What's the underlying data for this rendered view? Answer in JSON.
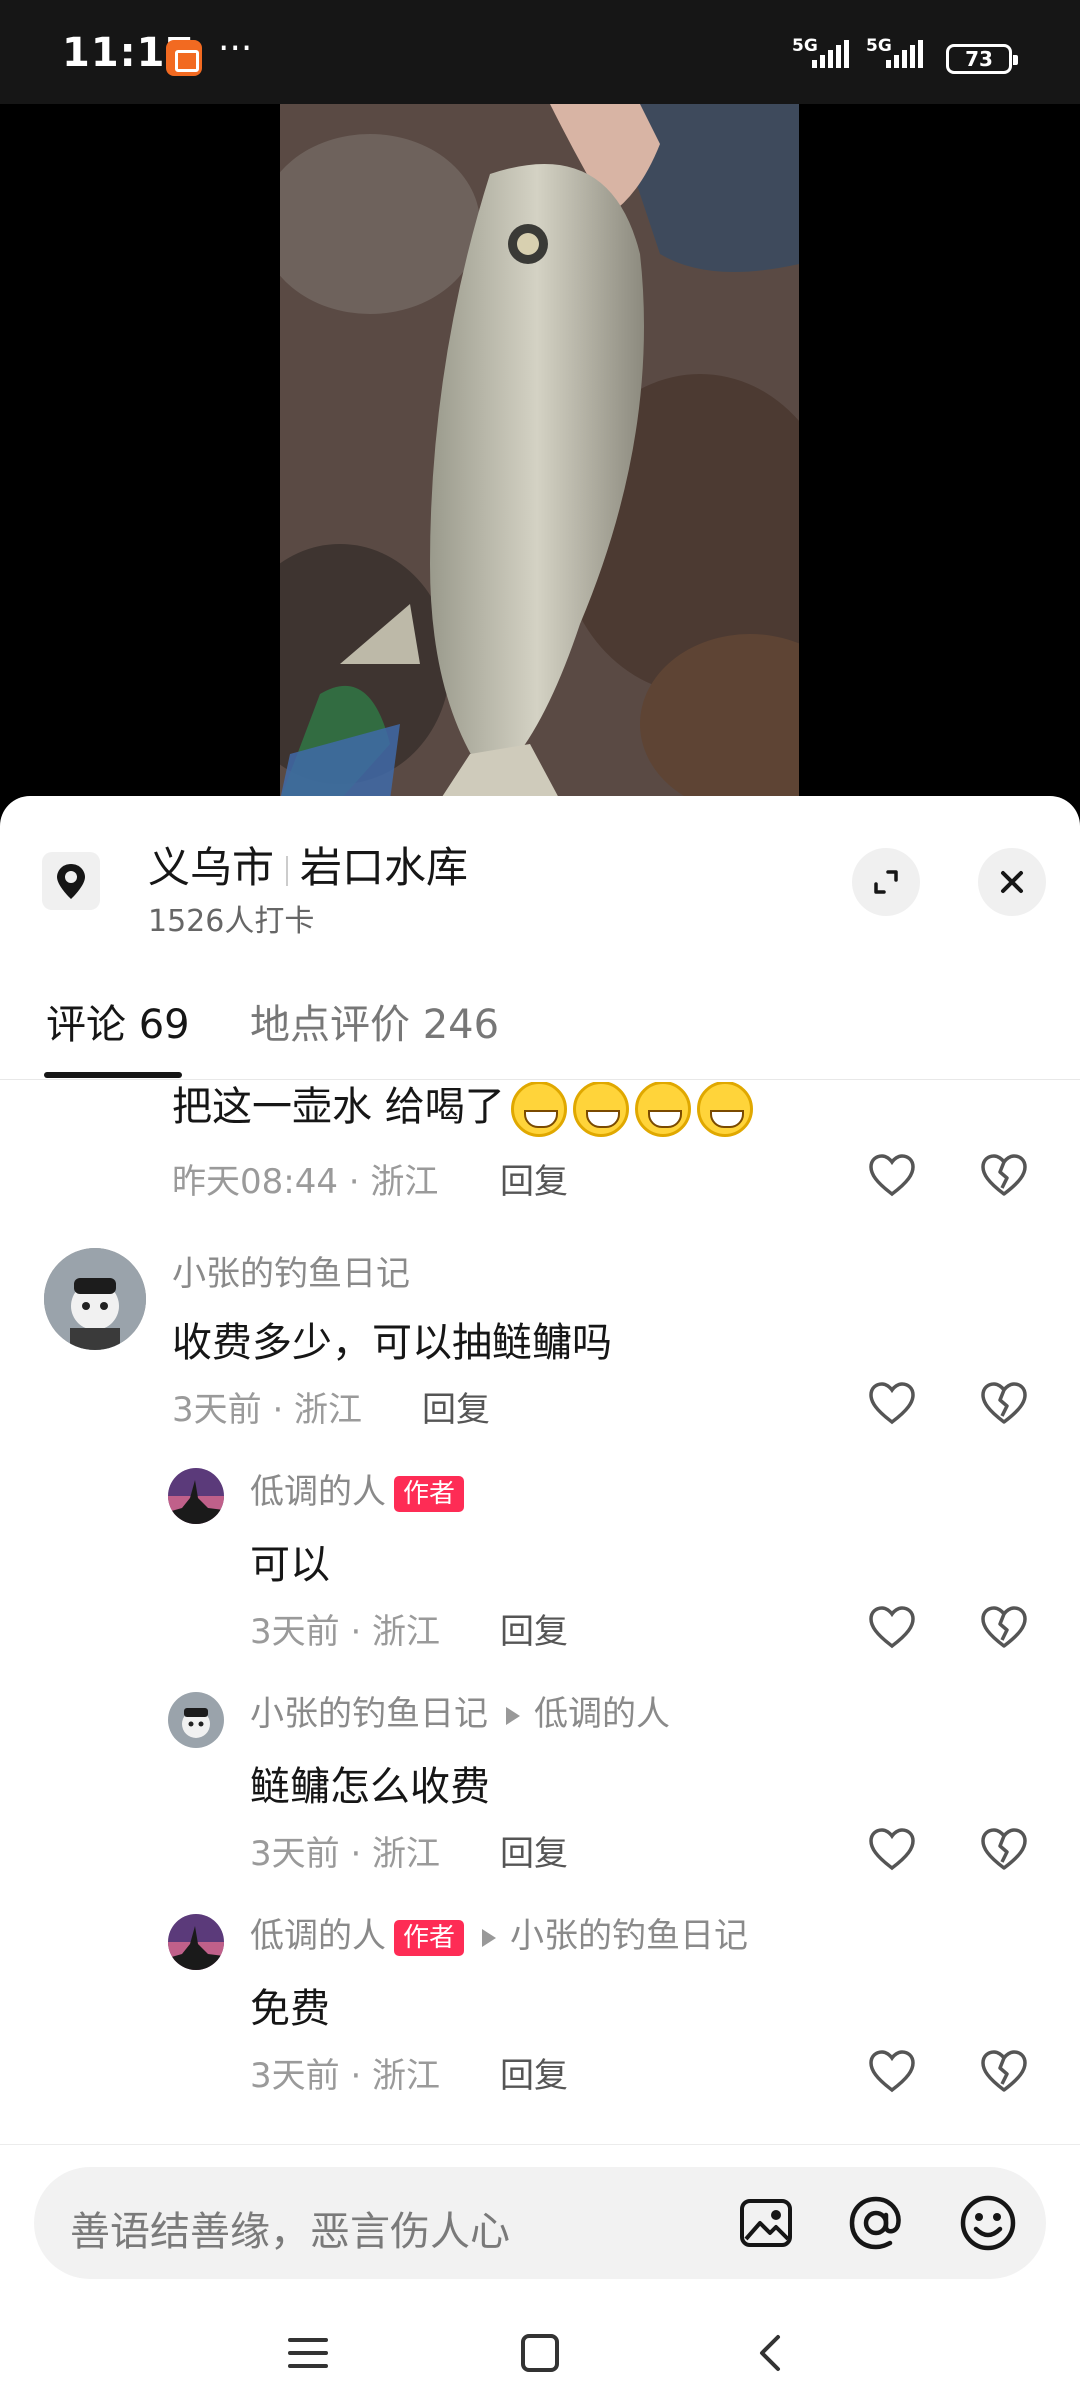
{
  "status_bar": {
    "time": "11:17",
    "dots": "···",
    "signal1_label": "5G",
    "signal2_label": "5G",
    "battery": "73"
  },
  "location": {
    "city": "义乌市",
    "place": "岩口水库",
    "checkins": "1526人打卡"
  },
  "tabs": {
    "comments": "评论 69",
    "reviews": "地点评价 246"
  },
  "comments": [
    {
      "text": "把这一壶水 给喝了",
      "emoji_count": 4,
      "time": "昨天08:44 · 浙江",
      "reply": "回复"
    },
    {
      "name": "小张的钓鱼日记",
      "text": "收费多少，可以抽鲢鳙吗",
      "time": "3天前 · 浙江",
      "reply": "回复"
    },
    {
      "name": "低调的人",
      "badge": "作者",
      "text": "可以",
      "time": "3天前 · 浙江",
      "reply": "回复"
    },
    {
      "name": "小张的钓鱼日记",
      "reply_to": "低调的人",
      "text": "鲢鳙怎么收费",
      "time": "3天前 · 浙江",
      "reply": "回复"
    },
    {
      "name": "低调的人",
      "badge": "作者",
      "reply_to": "小张的钓鱼日记",
      "text": "免费",
      "time": "3天前 · 浙江",
      "reply": "回复"
    }
  ],
  "input": {
    "placeholder": "善语结善缘，恶言伤人心"
  },
  "icons": {
    "location": "location-pin-icon",
    "expand": "expand-icon",
    "close": "close-icon",
    "like": "heart-icon",
    "dislike": "broken-heart-icon",
    "image": "image-icon",
    "mention": "at-icon",
    "emoji": "emoji-icon"
  },
  "colors": {
    "accent": "#fe2c55",
    "statusbar": "#161616"
  }
}
